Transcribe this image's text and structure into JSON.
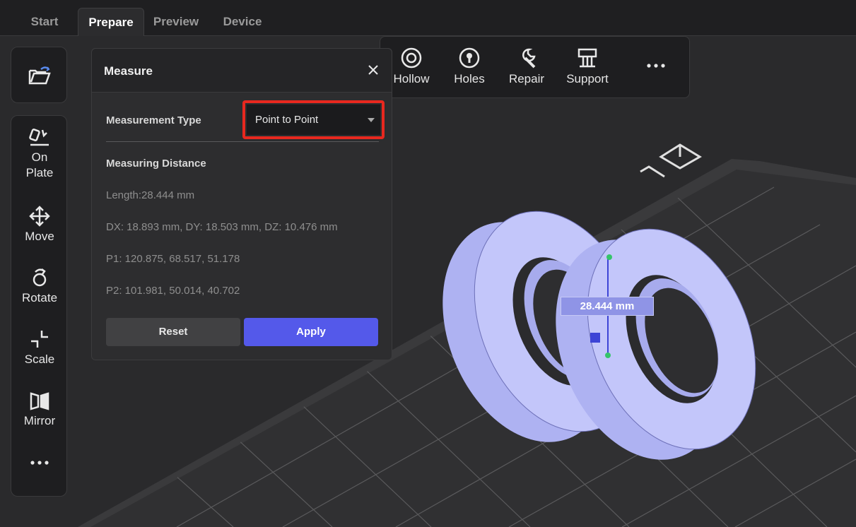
{
  "tabs": [
    {
      "label": "Start",
      "active": false
    },
    {
      "label": "Prepare",
      "active": true
    },
    {
      "label": "Preview",
      "active": false
    },
    {
      "label": "Device",
      "active": false
    }
  ],
  "left_toolbar": {
    "open_icon": "folder-open-icon",
    "items": [
      {
        "label": "On\nPlate",
        "icon": "on-plate-icon"
      },
      {
        "label": "Move",
        "icon": "move-icon"
      },
      {
        "label": "Rotate",
        "icon": "rotate-icon"
      },
      {
        "label": "Scale",
        "icon": "scale-icon"
      },
      {
        "label": "Mirror",
        "icon": "mirror-icon"
      },
      {
        "label": "",
        "icon": "more-icon"
      }
    ]
  },
  "top_toolbar": {
    "items": [
      {
        "label": "Hollow",
        "icon": "hollow-icon"
      },
      {
        "label": "Holes",
        "icon": "holes-icon"
      },
      {
        "label": "Repair",
        "icon": "wrench-icon"
      },
      {
        "label": "Support",
        "icon": "support-icon"
      },
      {
        "label": "",
        "icon": "more-icon"
      }
    ]
  },
  "measure_panel": {
    "title": "Measure",
    "measurement_type_label": "Measurement Type",
    "measurement_type_value": "Point to Point",
    "section_title": "Measuring Distance",
    "length": "Length:28.444 mm",
    "deltas": "DX: 18.893 mm, DY: 18.503 mm, DZ: 10.476 mm",
    "p1": "P1: 120.875, 68.517, 51.178",
    "p2": "P2: 101.981, 50.014, 40.702",
    "reset_label": "Reset",
    "apply_label": "Apply"
  },
  "viewport": {
    "distance_label": "28.444 mm"
  },
  "colors": {
    "accent": "#5459ea",
    "highlight": "#e8281f",
    "model": "#b9bdf6"
  }
}
